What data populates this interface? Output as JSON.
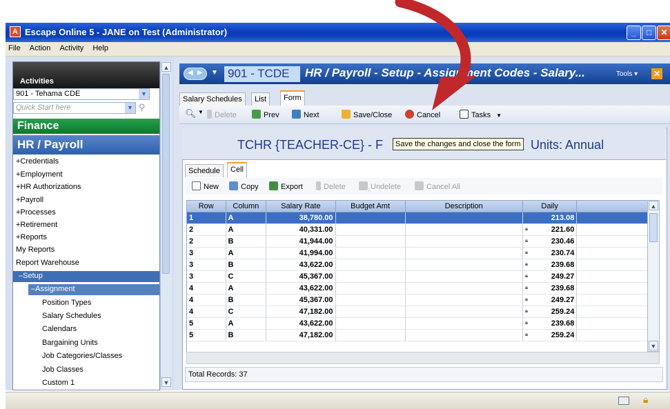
{
  "window": {
    "title": "Escape Online 5 - JANE on Test (Administrator)"
  },
  "menu": [
    "File",
    "Action",
    "Activity",
    "Help"
  ],
  "sidebar": {
    "header": "Activities",
    "district": "901 - Tehama CDE",
    "quick_start_placeholder": "Quick Start here",
    "finance": "Finance",
    "hr_payroll": "HR / Payroll",
    "items": [
      "+Credentials",
      "+Employment",
      "+HR Authorizations",
      "+Payroll",
      "+Processes",
      "+Retirement",
      "+Reports",
      "My Reports",
      "Report Warehouse"
    ],
    "setup": "–Setup",
    "assignment": "–Assignment",
    "sub_items": [
      "Position Types",
      "Salary Schedules",
      "Calendars",
      "Bargaining Units",
      "Job Categories/Classes",
      "Job Classes",
      "Custom 1"
    ]
  },
  "header": {
    "code": "901 - TCDE",
    "title": "HR / Payroll - Setup - Assignment Codes - Salary...",
    "tools": "Tools ▾"
  },
  "tabs": [
    "Salary Schedules",
    "List",
    "Form"
  ],
  "toolbar": {
    "delete": "Delete",
    "prev": "Prev",
    "next": "Next",
    "save_close": "Save/Close",
    "cancel": "Cancel",
    "tasks": "Tasks"
  },
  "form": {
    "title": "TCHR {TEACHER-CE} -  F... Units: Annual",
    "title_left": "TCHR {TEACHER-CE}  -  F",
    "title_right": "Units: Annual",
    "tooltip": "Save the changes and close the form"
  },
  "subtabs": [
    "Schedule",
    "Cell"
  ],
  "grid_toolbar": {
    "new": "New",
    "copy": "Copy",
    "export": "Export",
    "delete": "Delete",
    "undelete": "Undelete",
    "cancel_all": "Cancel All"
  },
  "grid": {
    "columns": [
      "Row",
      "Column",
      "Salary Rate",
      "Budget Amt",
      "Description",
      "Daily"
    ],
    "rows": [
      {
        "row": "1",
        "column": "A",
        "rate": "38,780.00",
        "daily": "213.08"
      },
      {
        "row": "2",
        "column": "A",
        "rate": "40,331.00",
        "daily": "221.60"
      },
      {
        "row": "2",
        "column": "B",
        "rate": "41,944.00",
        "daily": "230.46"
      },
      {
        "row": "3",
        "column": "A",
        "rate": "41,994.00",
        "daily": "230.74"
      },
      {
        "row": "3",
        "column": "B",
        "rate": "43,622.00",
        "daily": "239.68"
      },
      {
        "row": "3",
        "column": "C",
        "rate": "45,367.00",
        "daily": "249.27"
      },
      {
        "row": "4",
        "column": "A",
        "rate": "43,622.00",
        "daily": "239.68"
      },
      {
        "row": "4",
        "column": "B",
        "rate": "45,367.00",
        "daily": "249.27"
      },
      {
        "row": "4",
        "column": "C",
        "rate": "47,182.00",
        "daily": "259.24"
      },
      {
        "row": "5",
        "column": "A",
        "rate": "43,622.00",
        "daily": "239.68"
      },
      {
        "row": "5",
        "column": "B",
        "rate": "47,182.00",
        "daily": "259.24"
      }
    ],
    "total": "Total Records: 37"
  },
  "colors": {
    "accent": "#3c6fc4",
    "arrow": "#c0282c",
    "finance": "#0f8a36"
  }
}
